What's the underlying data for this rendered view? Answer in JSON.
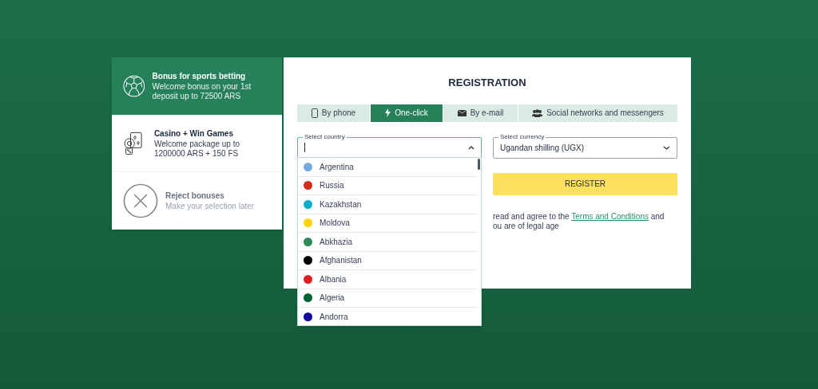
{
  "bonuses": [
    {
      "kind": "ball",
      "title": "Bonus for sports betting",
      "text": "Welcome bonus on your 1st deposit up to 72500 ARS",
      "selected": true
    },
    {
      "kind": "casino",
      "title": "Casino + Win Games",
      "text": "Welcome package up to 1200000 ARS + 150 FS",
      "selected": false
    },
    {
      "kind": "reject",
      "title": "Reject bonuses",
      "text": "Make your selection later",
      "selected": false
    }
  ],
  "registration": {
    "title": "REGISTRATION",
    "tabs": [
      {
        "kind": "phone",
        "label": "By phone",
        "selected": false
      },
      {
        "kind": "bolt",
        "label": "One-click",
        "selected": true
      },
      {
        "kind": "mail",
        "label": "By e-mail",
        "selected": false
      },
      {
        "kind": "people",
        "label": "Social networks and messengers",
        "selected": false
      }
    ],
    "country": {
      "label": "Select country",
      "expanded": true
    },
    "currency": {
      "label": "Select currency",
      "value": "Ugandan shilling (UGX)"
    },
    "register_button": "REGISTER",
    "agreement": {
      "text": "read and agree to the",
      "link": "Terms and Conditions",
      "after": "and",
      "line2": "ou are of legal age"
    },
    "countries": [
      {
        "name": "Argentina",
        "color": "#74acdf"
      },
      {
        "name": "Russia",
        "color": "#d52b1e"
      },
      {
        "name": "Kazakhstan",
        "color": "#00afca"
      },
      {
        "name": "Moldova",
        "color": "#ffd200"
      },
      {
        "name": "Abkhazia",
        "color": "#2e8b57"
      },
      {
        "name": "Afghanistan",
        "color": "#000000"
      },
      {
        "name": "Albania",
        "color": "#e41e20"
      },
      {
        "name": "Algeria",
        "color": "#006233"
      },
      {
        "name": "Andorra",
        "color": "#10069f"
      }
    ]
  }
}
